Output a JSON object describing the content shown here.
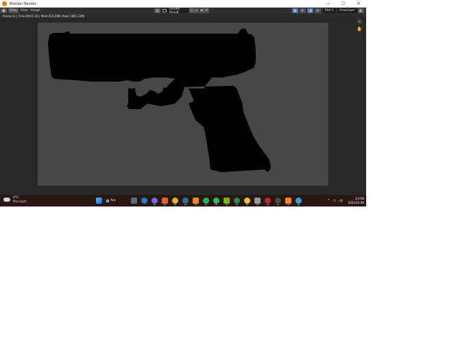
{
  "window": {
    "title": "Blender Render",
    "controls": [
      "—",
      "☐",
      "✕"
    ]
  },
  "header": {
    "menus": [
      "View",
      "View",
      "Image"
    ],
    "image_name": "Render Result",
    "slot": "Slot 1",
    "view_layer": "ViewLayer"
  },
  "status": {
    "text": "Frame:11 | Time:00:01.30 | Mem:423.09M (Peak 1801.23M)"
  },
  "weather": {
    "temp": "0°C",
    "condition": "Moonlight"
  },
  "taskbar": {
    "search_label": "Ara",
    "apps": [
      {
        "name": "task-view",
        "color": "#5d6a77"
      },
      {
        "name": "edge",
        "color": "#1f7fd0"
      },
      {
        "name": "discord",
        "color": "#6d6de0"
      },
      {
        "name": "firefox",
        "color": "#e8602c"
      },
      {
        "name": "chrome",
        "color": "#e0b62a"
      },
      {
        "name": "steam",
        "color": "#2a6fa5"
      },
      {
        "name": "vlc",
        "color": "#f08a1c"
      },
      {
        "name": "spotify",
        "color": "#1db954"
      },
      {
        "name": "whatsapp",
        "color": "#25c166"
      },
      {
        "name": "nvidia",
        "color": "#76b900"
      },
      {
        "name": "excel",
        "color": "#1f8f4e"
      },
      {
        "name": "file-explorer",
        "color": "#f2c230"
      },
      {
        "name": "photos",
        "color": "#9a9a9a"
      },
      {
        "name": "winrar",
        "color": "#b8262e"
      },
      {
        "name": "terminal",
        "color": "#4a4a4a"
      },
      {
        "name": "blender",
        "color": "#f5871f"
      },
      {
        "name": "browser",
        "color": "#2aa6d8"
      }
    ]
  },
  "clock": {
    "time": "13:58",
    "date": "2023-01-06"
  },
  "colors": {
    "blender_header": "#303030",
    "render_background": "#474747",
    "silhouette": "#000000",
    "taskbar": "#2a1713"
  }
}
